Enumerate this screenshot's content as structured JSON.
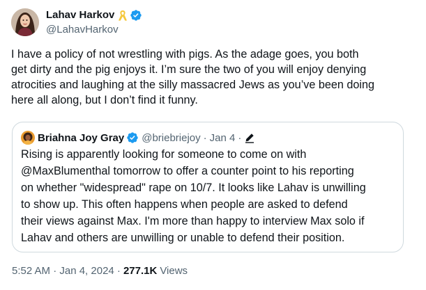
{
  "author": {
    "name": "Lahav Harkov",
    "handle": "@LahavHarkov"
  },
  "tweet": {
    "text": "I have a policy of not wrestling with pigs. As the adage goes, you both\nget dirty and the pig enjoys it. I’m sure the two of you will enjoy denying\natrocities and laughing at the silly massacred Jews as you’ve been doing\nhere all along, but I don’t find it funny."
  },
  "quoted": {
    "name": "Briahna Joy Gray",
    "handle": "@briebriejoy",
    "separator1": "·",
    "date": "Jan 4",
    "separator2": "·",
    "text": "Rising is apparently looking for someone to come on with\n@MaxBlumenthal tomorrow to offer a counter point to his reporting\non whether \"widespread\" rape on 10/7. It looks like Lahav is unwilling\nto show up. This often happens when people are asked to defend\ntheir views against Max. I'm more than happy to interview Max solo if\nLahav and others are unwilling or unable to defend their position."
  },
  "footer": {
    "timestamp": "5:52 AM · Jan 4, 2024 ·",
    "views_count": "277.1K",
    "views_label": "Views"
  },
  "colors": {
    "verified": "#1d9bf0",
    "ribbon": "#f5c83b",
    "secondary_text": "#536471",
    "border": "#cfd9de"
  },
  "icons": {
    "author_badges": [
      "yellow-ribbon-icon",
      "verified-badge-icon"
    ],
    "quoted_badges": [
      "verified-badge-icon",
      "edit-pencil-icon"
    ]
  }
}
